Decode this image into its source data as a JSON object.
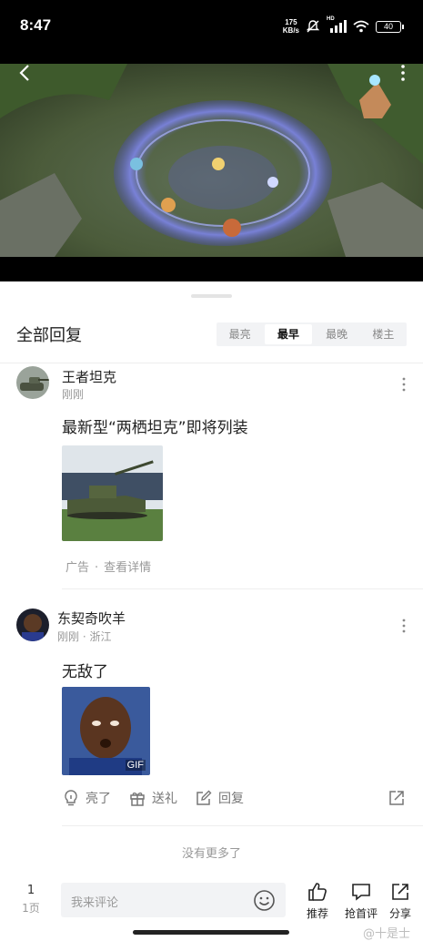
{
  "status_bar": {
    "time": "8:47",
    "net_speed_value": "175",
    "net_speed_unit": "KB/s",
    "signal_label": "HD",
    "battery": "40"
  },
  "video": {
    "back_icon": "chevron-left-icon",
    "more_icon": "vertical-dots-icon"
  },
  "comments_header": {
    "title": "全部回复",
    "sort_tabs": [
      {
        "label": "最亮",
        "active": false
      },
      {
        "label": "最早",
        "active": true
      },
      {
        "label": "最晚",
        "active": false
      },
      {
        "label": "楼主",
        "active": false
      }
    ]
  },
  "comments": [
    {
      "username": "王者坦克",
      "meta": "刚刚",
      "text": "最新型“两栖坦克”即将列装",
      "image_icon": "tank-photo",
      "ad_label": "广告",
      "ad_link": "查看详情"
    },
    {
      "username": "东契奇吹羊",
      "meta": "刚刚 · 浙江",
      "text": "无敌了",
      "image_icon": "reaction-gif",
      "gif_badge": "GIF",
      "actions": {
        "light": "亮了",
        "gift": "送礼",
        "reply": "回复"
      }
    }
  ],
  "no_more_text": "没有更多了",
  "bottom_bar": {
    "page_number": "1",
    "page_label": "1页",
    "input_placeholder": "我来评论",
    "recommend_label": "推荐",
    "first_comment_label": "抢首评",
    "share_label": "分享"
  },
  "watermark": "@十是士",
  "colors": {
    "accent_text": "#222222",
    "muted_text": "#999999",
    "tab_bg": "#f2f3f5"
  }
}
